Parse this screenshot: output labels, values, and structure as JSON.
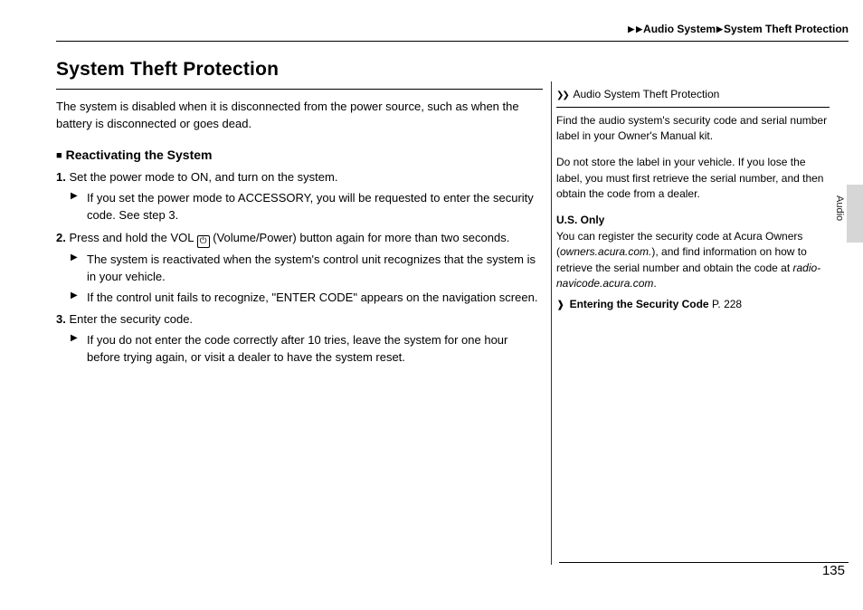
{
  "breadcrumb": {
    "level1": "Audio System",
    "level2": "System Theft Protection"
  },
  "title": "System Theft Protection",
  "intro": "The system is disabled when it is disconnected from the power source, such as when the battery is disconnected or goes dead.",
  "subhead": "Reactivating the System",
  "step1": {
    "num": "1.",
    "text": "Set the power mode to ON, and turn on the system.",
    "sub": "If you set the power mode to ACCESSORY, you will be requested to enter the security code. See step 3."
  },
  "step2": {
    "num": "2.",
    "pre": "Press and hold the VOL ",
    "post": " (Volume/Power) button again for more than two seconds.",
    "sub1": "The system is reactivated when the system's control unit recognizes that the system is in your vehicle.",
    "sub2": "If the control unit fails to recognize, \"ENTER CODE\" appears on the navigation screen."
  },
  "step3": {
    "num": "3.",
    "text": "Enter the security code.",
    "sub": "If you do not enter the code correctly after 10 tries, leave the system for one hour before trying again, or visit a dealer to have the system reset."
  },
  "sidebar": {
    "title": "Audio System Theft Protection",
    "p1": "Find the audio system's security code and serial number label in your Owner's Manual kit.",
    "p2": "Do not store the label in your vehicle. If you lose the label, you must first retrieve the serial number, and then obtain the code from a dealer.",
    "us_head": "U.S. Only",
    "us_pre": "You can register the security code at Acura Owners (",
    "us_link1": "owners.acura.com.",
    "us_mid": "), and find information on how to retrieve the serial number and obtain the code at ",
    "us_link2": "radio-navicode.acura.com",
    "us_post": ".",
    "xref_label": "Entering the Security Code",
    "xref_page": "P. 228"
  },
  "tab": "Audio",
  "page_number": "135"
}
